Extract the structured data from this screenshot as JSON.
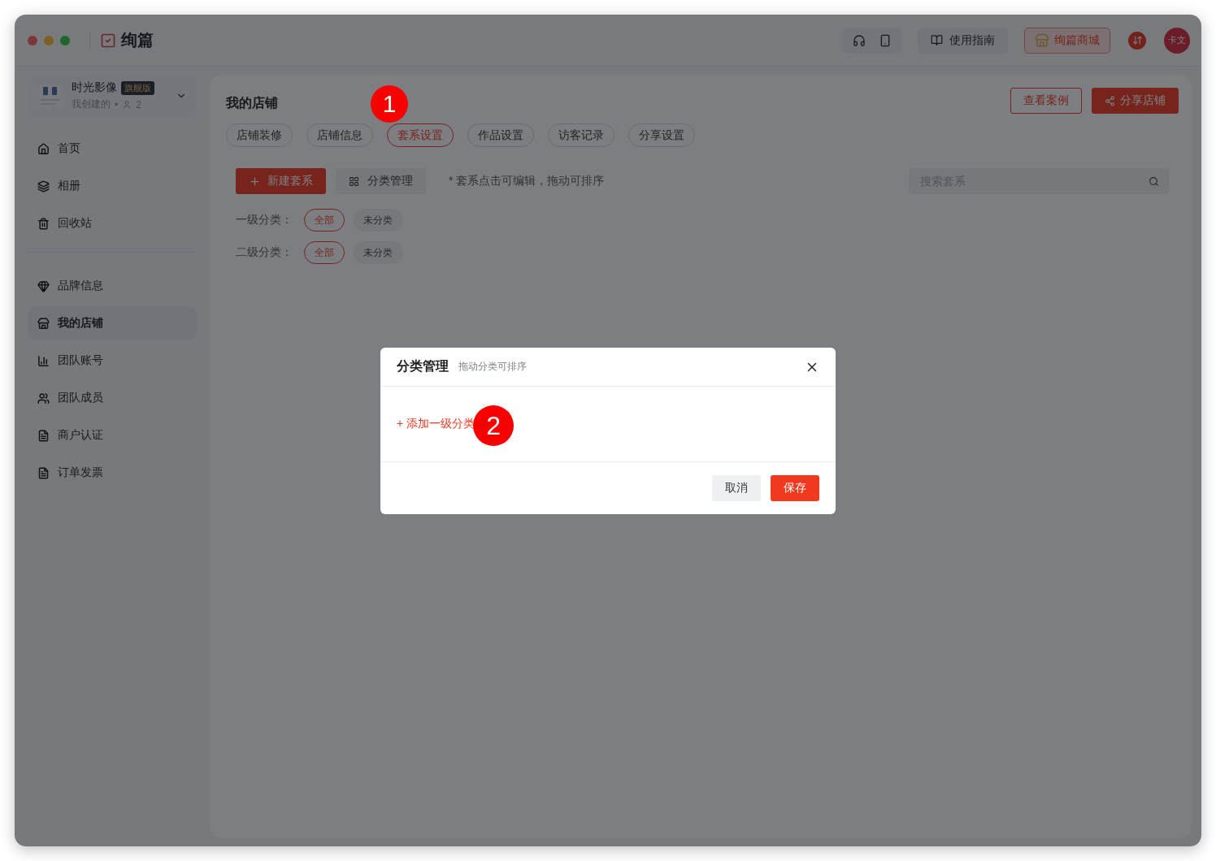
{
  "app": {
    "name": "绚篇"
  },
  "toolbar": {
    "guide": "使用指南",
    "mall": "绚篇商城",
    "avatar": "卡文"
  },
  "workspace": {
    "name": "时光影像",
    "badge": "旗舰版",
    "owner": "我创建的",
    "separator": "•",
    "members": "2"
  },
  "sidebar": {
    "groups": [
      [
        {
          "label": "首页",
          "selected": false
        },
        {
          "label": "相册",
          "selected": false
        },
        {
          "label": "回收站",
          "selected": false
        }
      ],
      [
        {
          "label": "品牌信息",
          "selected": false
        },
        {
          "label": "我的店铺",
          "selected": true
        },
        {
          "label": "团队账号",
          "selected": false
        },
        {
          "label": "团队成员",
          "selected": false
        },
        {
          "label": "商户认证",
          "selected": false
        },
        {
          "label": "订单发票",
          "selected": false
        }
      ]
    ]
  },
  "page": {
    "title": "我的店铺",
    "actions": [
      {
        "label": "查看案例",
        "kind": "outline"
      },
      {
        "label": "分享店铺",
        "kind": "primary"
      }
    ],
    "tabs": [
      {
        "label": "店铺装修",
        "selected": false
      },
      {
        "label": "店铺信息",
        "selected": false
      },
      {
        "label": "套系设置",
        "selected": true
      },
      {
        "label": "作品设置",
        "selected": false
      },
      {
        "label": "访客记录",
        "selected": false
      },
      {
        "label": "分享设置",
        "selected": false
      }
    ],
    "new_button": "新建套系",
    "manage_button": "分类管理",
    "hint": "* 套系点击可编辑，拖动可排序",
    "search": {
      "placeholder": "搜索套系"
    },
    "filters": [
      {
        "label": "一级分类：",
        "chips": [
          {
            "label": "全部",
            "selected": true
          },
          {
            "label": "未分类",
            "selected": false
          }
        ]
      },
      {
        "label": "二级分类：",
        "chips": [
          {
            "label": "全部",
            "selected": true
          },
          {
            "label": "未分类",
            "selected": false
          }
        ]
      }
    ]
  },
  "dialog": {
    "title": "分类管理",
    "subtitle": "拖动分类可排序",
    "add_link": "+ 添加一级分类",
    "buttons": [
      {
        "label": "取消",
        "kind": "secondary"
      },
      {
        "label": "保存",
        "kind": "primary"
      }
    ]
  },
  "annotations": [
    {
      "label": "1"
    },
    {
      "label": "2"
    }
  ]
}
